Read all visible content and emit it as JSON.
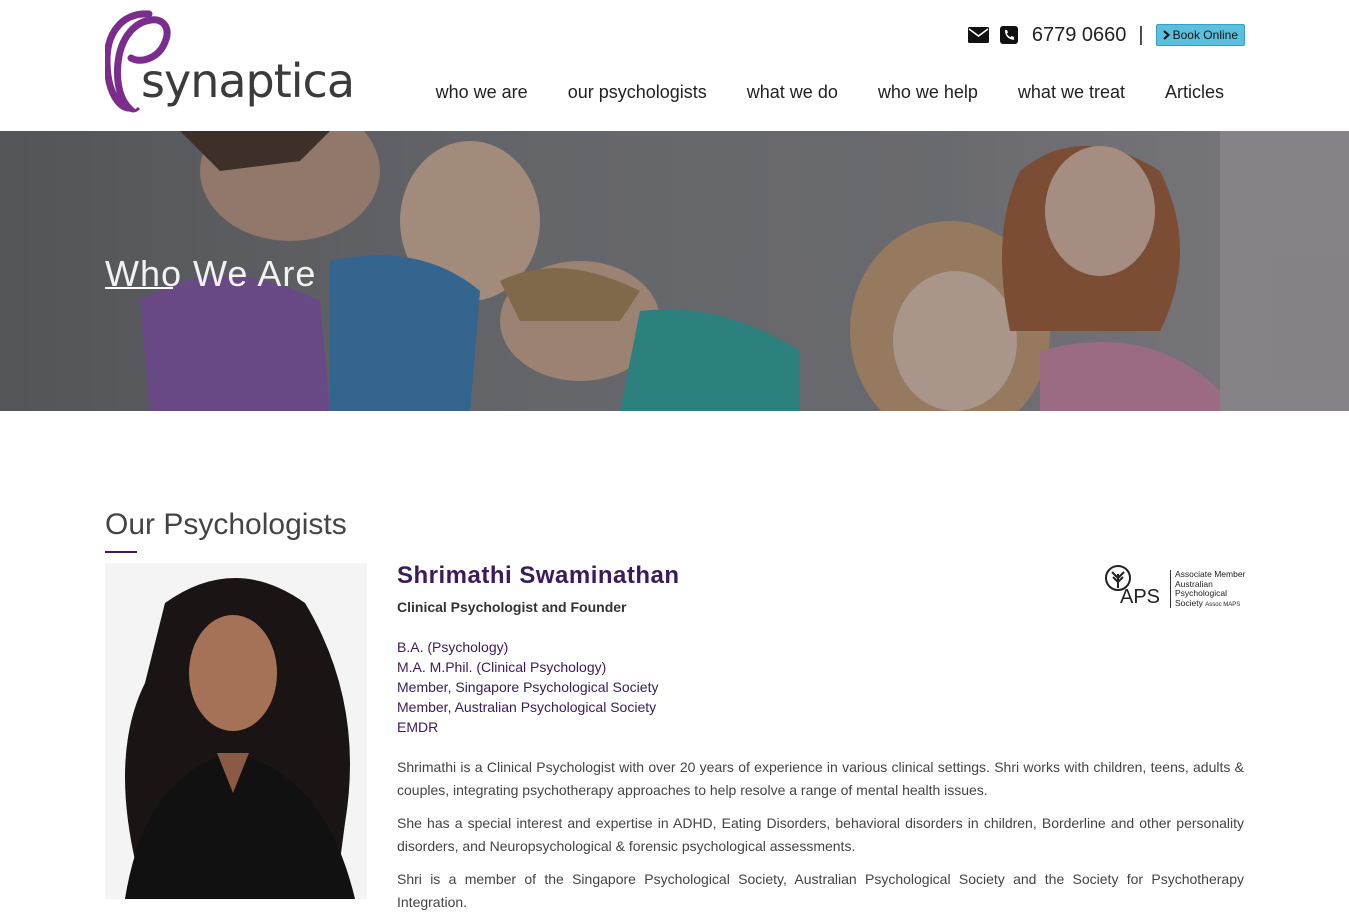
{
  "brand": {
    "logo_text": "synaptica",
    "accent_color": "#3d1a5b",
    "logo_swirl_color": "#7b2d8e"
  },
  "topbar": {
    "email_icon": "envelope-icon",
    "phone_icon": "phone-icon",
    "phone_number": "6779 0660",
    "separator": "|",
    "book_label": "Book Online",
    "book_icon": "chevron-right-icon",
    "book_color": "#5bc0de"
  },
  "nav": {
    "items": [
      {
        "label": "who we are"
      },
      {
        "label": "our psychologists"
      },
      {
        "label": "what we do"
      },
      {
        "label": "who we help"
      },
      {
        "label": "what we treat"
      },
      {
        "label": "Articles"
      }
    ]
  },
  "hero": {
    "title": "Who We Are"
  },
  "section": {
    "title": "Our Psychologists"
  },
  "psychologist": {
    "name": "Shrimathi Swaminathan",
    "role": "Clinical Psychologist and Founder",
    "qualifications": [
      "B.A. (Psychology)",
      "M.A. M.Phil. (Clinical Psychology)",
      "Member, Singapore Psychological Society",
      "Member, Australian Psychological Society",
      "EMDR"
    ],
    "bio": [
      "Shrimathi is a Clinical Psychologist with over 20 years of experience in various clinical settings. Shri works with children, teens, adults & couples, integrating psychotherapy approaches to help resolve a range of mental health issues.",
      "She has a special interest and expertise in ADHD, Eating Disorders, behavioral disorders in children, Borderline and other personality disorders, and Neuropsychological & forensic psychological assessments.",
      "Shri is a member of the Singapore Psychological Society, Australian Psychological Society and the Society for Psychotherapy Integration."
    ]
  },
  "aps_badge": {
    "abbr": "APS",
    "lines": [
      "Associate Member",
      "Australian",
      "Psychological",
      "Society"
    ],
    "suffix": "Assoc MAPS"
  }
}
